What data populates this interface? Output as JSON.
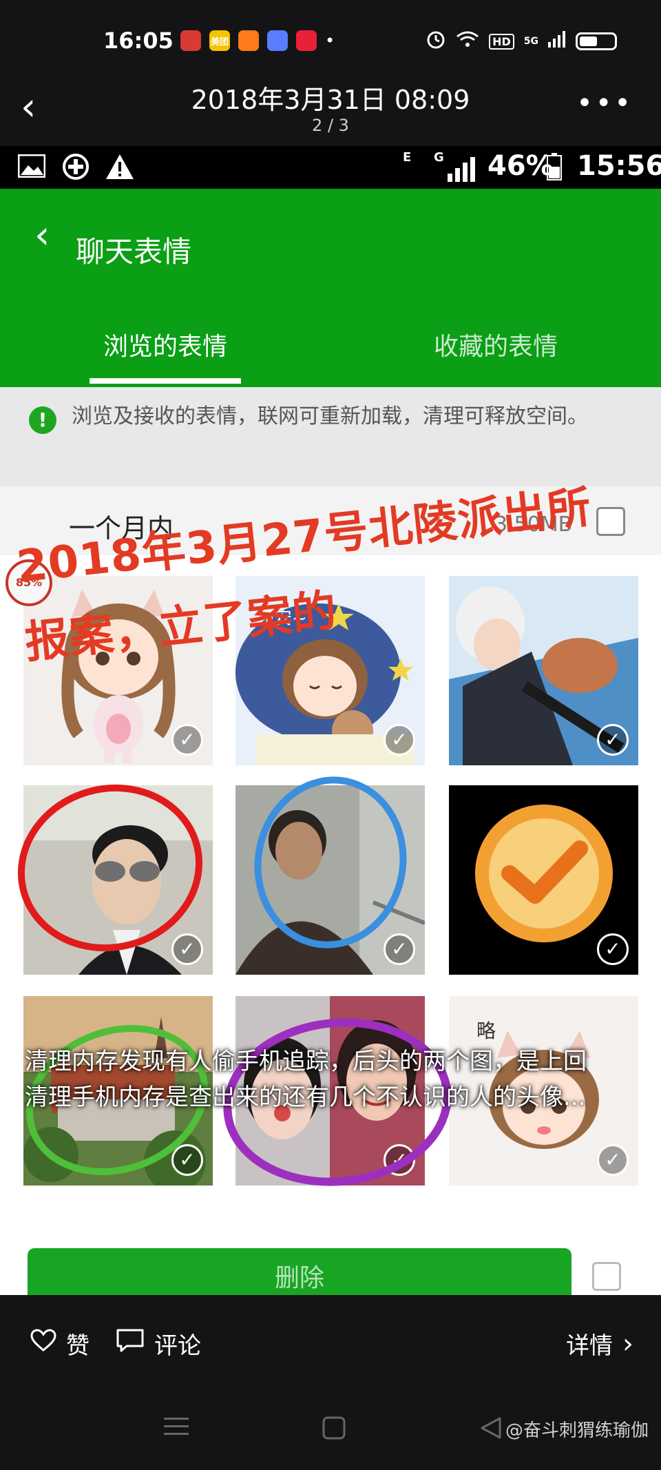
{
  "status_bar": {
    "time": "16:05",
    "app_badges": [
      {
        "name": "netease-music-icon",
        "label": "",
        "color": "#d93a32"
      },
      {
        "name": "meituan-icon",
        "label": "美团",
        "color": "#f5c400"
      },
      {
        "name": "app-icon-orange",
        "label": "",
        "color": "#ff7a1a"
      },
      {
        "name": "app-icon-colorful",
        "label": "",
        "color": "#5a7cff"
      },
      {
        "name": "app-icon-red",
        "label": "",
        "color": "#e8203a"
      }
    ],
    "dot": "•",
    "network_label": "HD",
    "signal_label": "5G"
  },
  "viewer": {
    "title": "2018年3月31日 08:09",
    "page_indicator": "2 / 3"
  },
  "inner_screenshot": {
    "status": {
      "sim_e": "E",
      "sim_g": "G",
      "battery": "46%",
      "time": "15:56"
    },
    "header": {
      "title": "聊天表情",
      "tabs": [
        {
          "label": "浏览的表情",
          "active": true
        },
        {
          "label": "收藏的表情",
          "active": false
        }
      ]
    },
    "notice": {
      "text": "浏览及接收的表情，联网可重新加载，清理可释放空间。"
    },
    "section": {
      "label": "一个月内",
      "size": "3.50MB"
    },
    "progress_badge": "85%",
    "delete_button": "删除",
    "annotation": {
      "line1": "2018年3月27号北陵派出所",
      "line2": "报案，立了案的"
    },
    "grid": [
      {
        "name": "cartoon-girl-sticker",
        "checked": true
      },
      {
        "name": "sleeping-girl-sticker",
        "checked": true
      },
      {
        "name": "anime-boy-sticker",
        "checked": true
      },
      {
        "name": "man-sunglasses-photo",
        "checked": true
      },
      {
        "name": "woman-photo",
        "checked": true
      },
      {
        "name": "orange-check-sticker",
        "checked": true
      },
      {
        "name": "castle-photo",
        "checked": true
      },
      {
        "name": "children-photo",
        "checked": true
      },
      {
        "name": "cartoon-girl-sticker-2",
        "checked": true
      }
    ]
  },
  "caption": {
    "line1": "清理内存发现有人偷手机追踪，后头的两个图，是上回",
    "line2": "清理手机内存是查出来的还有几个不认识的人的头像..."
  },
  "actions": {
    "like": "赞",
    "comment": "评论",
    "detail": "详情"
  },
  "watermark": "@奋斗刺猬练瑜伽"
}
